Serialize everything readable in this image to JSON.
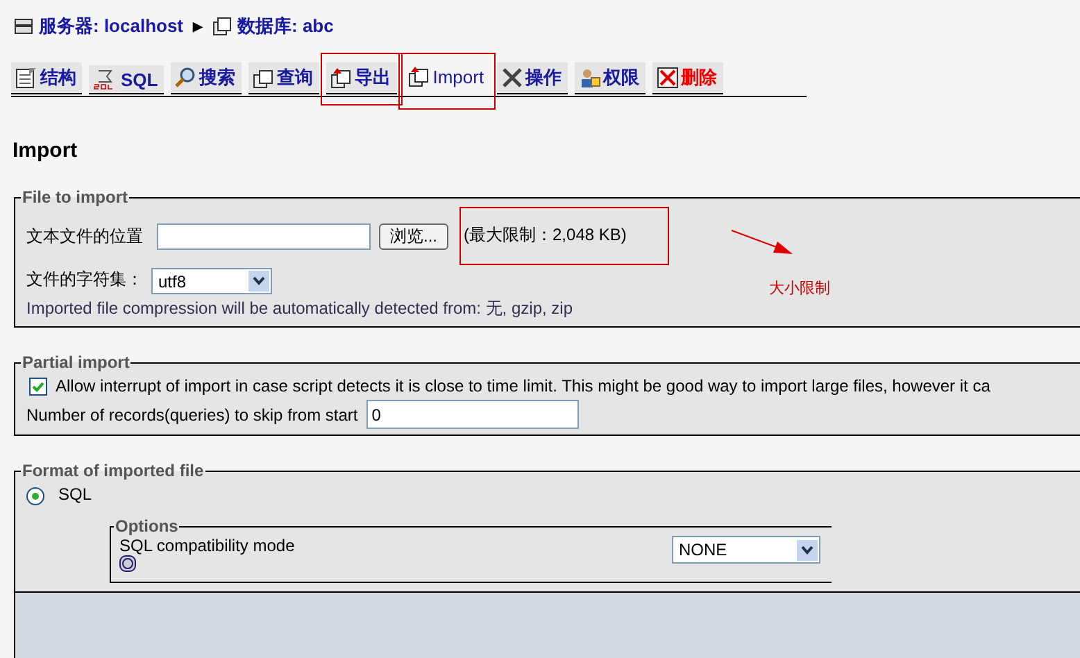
{
  "breadcrumb": {
    "server": "服务器: localhost",
    "separator": "▶",
    "database": "数据库: abc"
  },
  "tabs": [
    {
      "label": "结构",
      "selected": false,
      "kind": "normal",
      "annotated": false
    },
    {
      "label": "SQL",
      "selected": false,
      "kind": "normal",
      "annotated": false
    },
    {
      "label": "搜索",
      "selected": false,
      "kind": "normal",
      "annotated": false
    },
    {
      "label": "查询",
      "selected": false,
      "kind": "normal",
      "annotated": false
    },
    {
      "label": "导出",
      "selected": false,
      "kind": "normal",
      "annotated": true
    },
    {
      "label": "Import",
      "selected": true,
      "kind": "normal",
      "annotated": true
    },
    {
      "label": "操作",
      "selected": false,
      "kind": "normal",
      "annotated": false
    },
    {
      "label": "权限",
      "selected": false,
      "kind": "normal",
      "annotated": false
    },
    {
      "label": "删除",
      "selected": false,
      "kind": "danger",
      "annotated": false
    }
  ],
  "heading": "Import",
  "file_section": {
    "legend": "File to import",
    "file_label": "文本文件的位置",
    "browse_button": "浏览...",
    "size_limit": "(最大限制：2,048 KB)",
    "size_limit_annotated": true,
    "annotation_label": "大小限制",
    "charset_label": "文件的字符集：",
    "charset_value": "utf8",
    "compression_note": "Imported file compression will be automatically detected from: 无, gzip, zip"
  },
  "partial_section": {
    "legend": "Partial import",
    "allow_interrupt_label": "Allow interrupt of import in case script detects it is close to time limit. This might be good way to import large files, however it ca",
    "allow_interrupt_checked": true,
    "skip_label": "Number of records(queries) to skip from start",
    "skip_value": "0"
  },
  "format_section": {
    "legend": "Format of imported file",
    "format_label": "SQL",
    "format_selected": true,
    "options_legend": "Options",
    "compat_label": "SQL compatibility mode",
    "compat_value": "NONE"
  }
}
